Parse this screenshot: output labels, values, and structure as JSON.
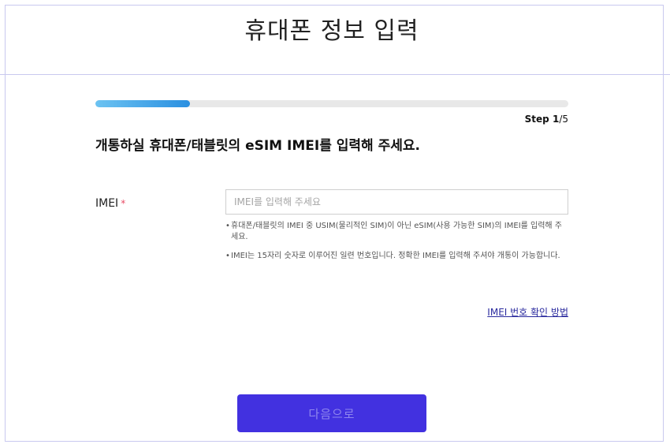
{
  "header": {
    "title": "휴대폰 정보 입력"
  },
  "progress": {
    "fraction": 0.2,
    "step_prefix": "Step ",
    "current": "1",
    "total": "/5"
  },
  "main": {
    "headline": "개통하실 휴대폰/태블릿의 eSIM IMEI를 입력해 주세요.",
    "field": {
      "label": "IMEI",
      "required_mark": "*",
      "placeholder": "IMEI를 입력해 주세요",
      "value": ""
    },
    "notes": [
      "휴대폰/태블릿의 IMEI 중 USIM(물리적인 SIM)이 아닌 eSIM(사용 가능한 SIM)의 IMEI를 입력해 주세요.",
      "IMEI는 15자리 숫자로 이루어진 일련 번호입니다. 정확한 IMEI를 입력해 주셔야 개통이 가능합니다."
    ],
    "bullet": "•",
    "help_link": "IMEI 번호 확인 방법"
  },
  "footer": {
    "next_label": "다음으로"
  },
  "colors": {
    "accent": "#4231e0",
    "progress_start": "#6cc3f2",
    "progress_end": "#2a8fe0",
    "required": "#e94b64"
  }
}
